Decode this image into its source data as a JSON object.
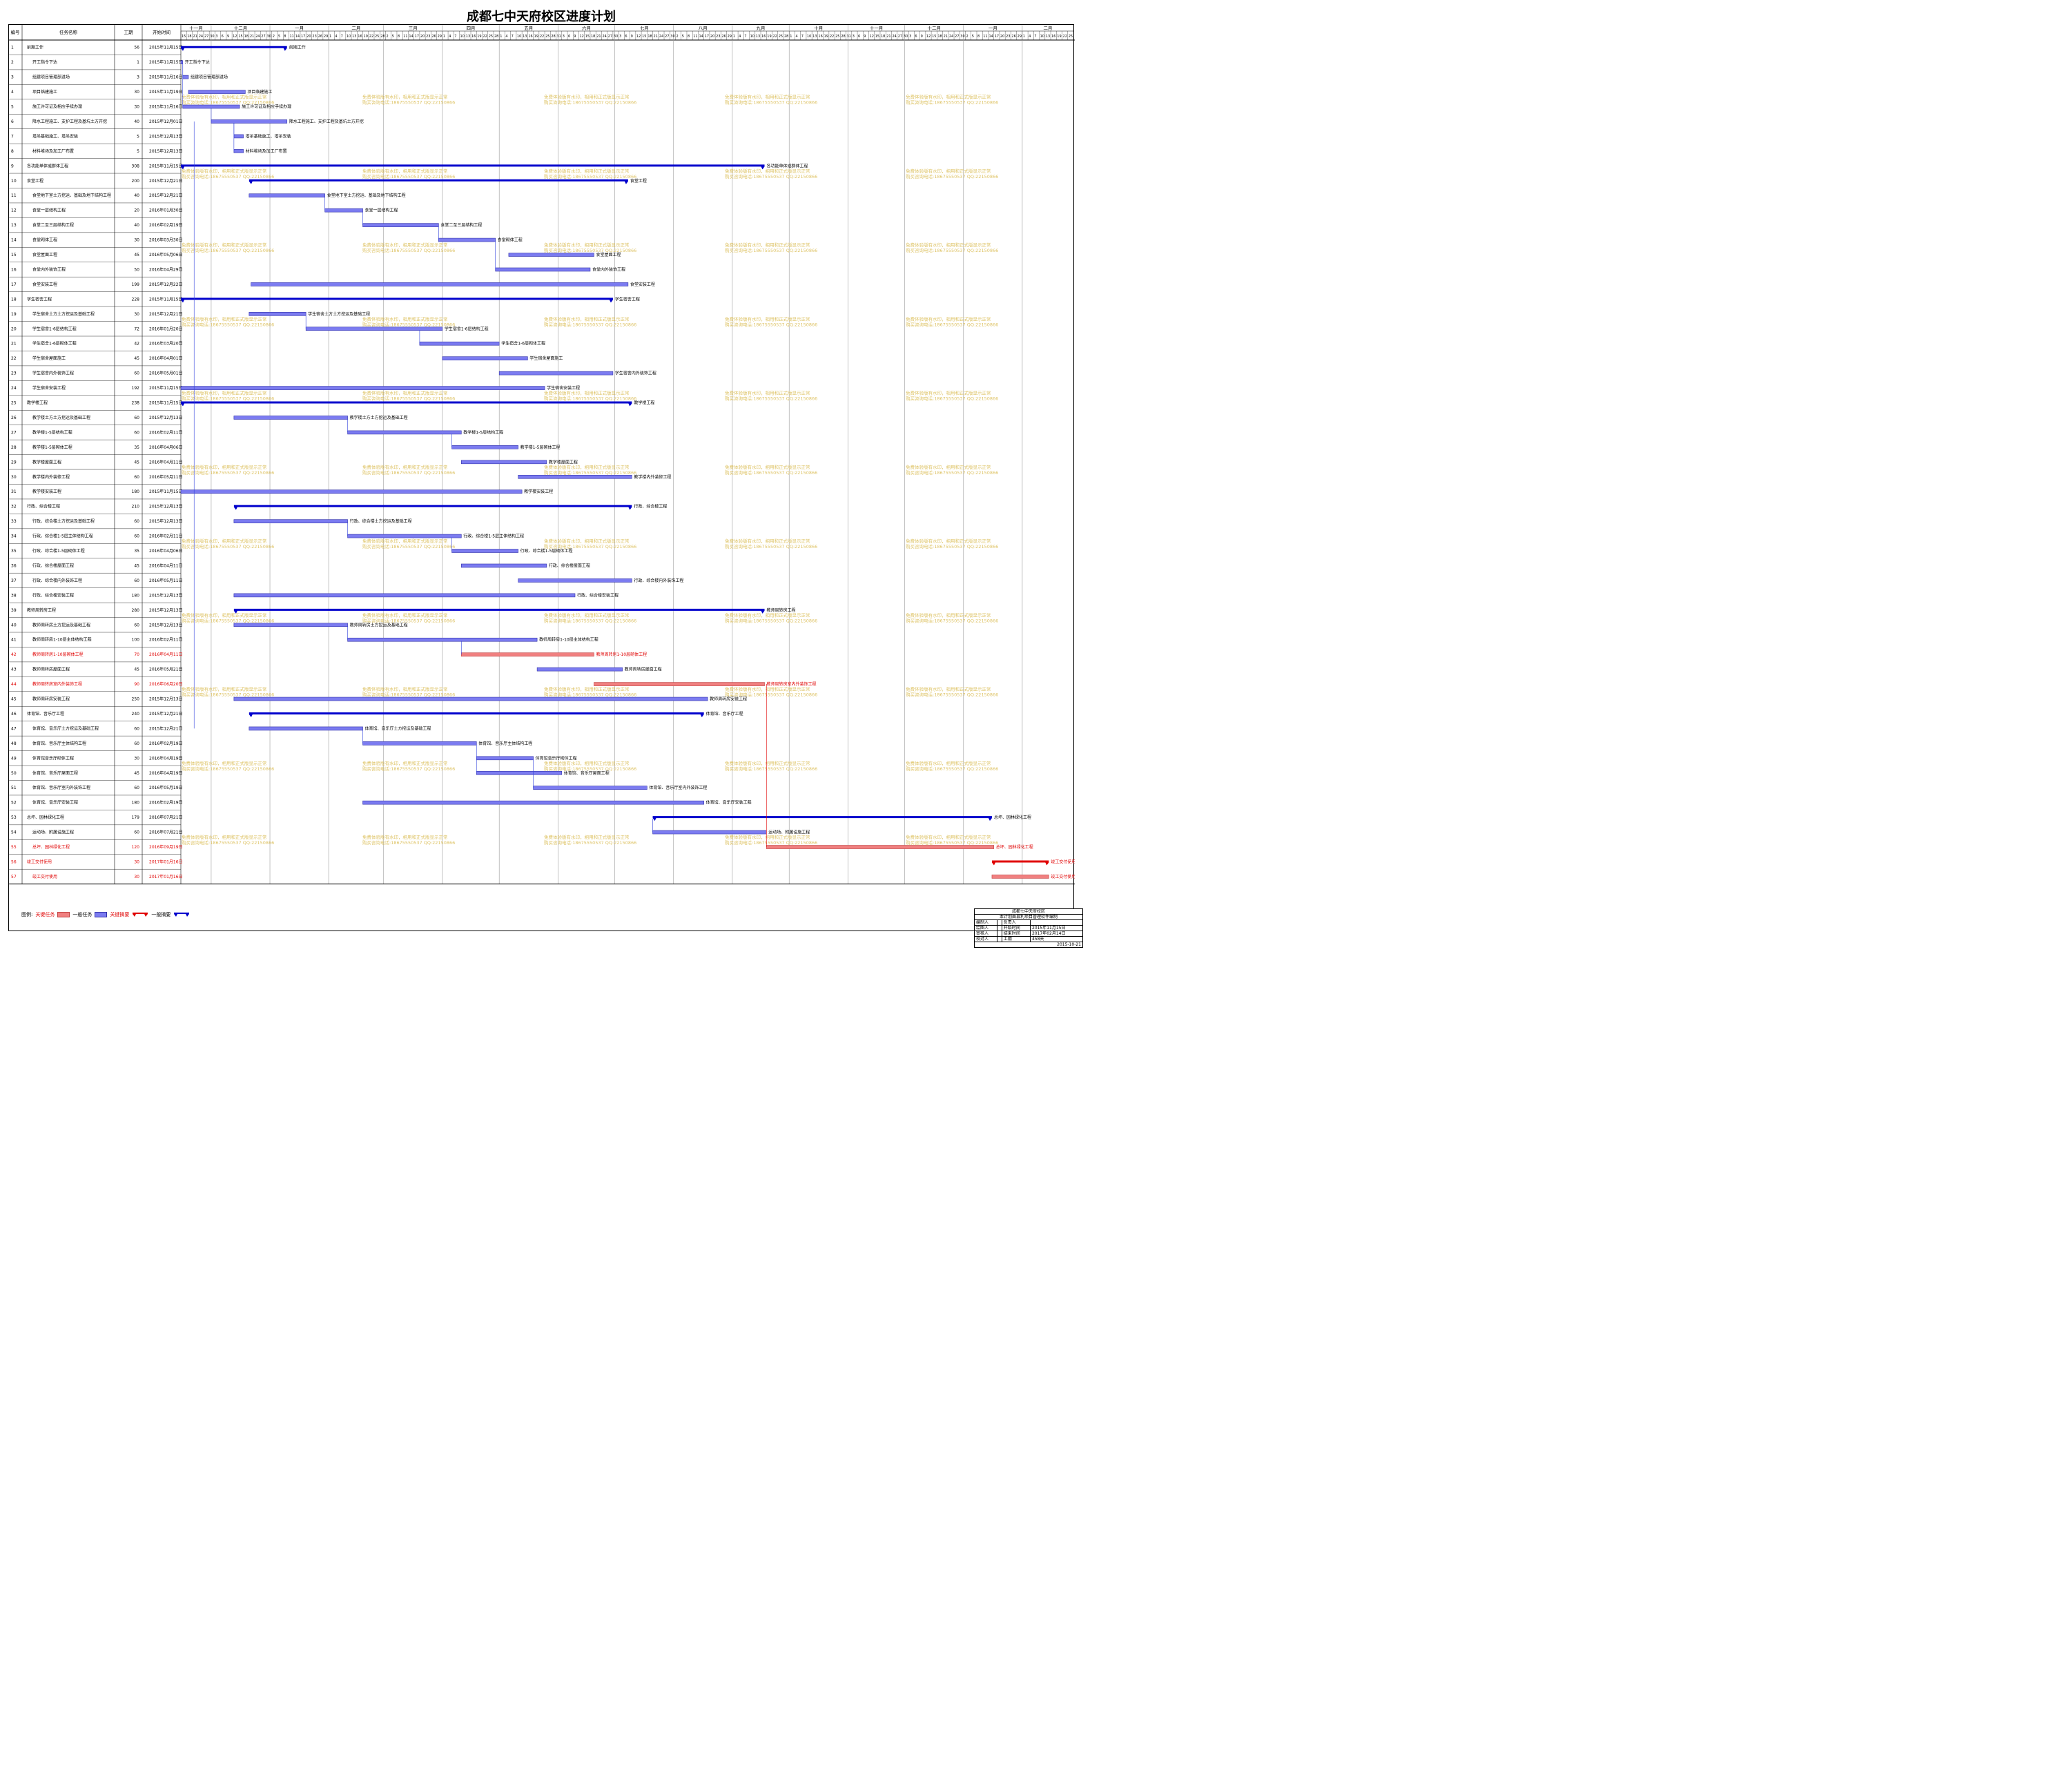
{
  "title": "成都七中天府校区进度计划",
  "columns": {
    "id": "编号",
    "name": "任务名称",
    "duration": "工期",
    "start": "开始时间"
  },
  "months": [
    {
      "label": "十一月",
      "start": "2015-11-01"
    },
    {
      "label": "十二月",
      "start": "2015-12-01"
    },
    {
      "label": "一月",
      "start": "2016-01-01"
    },
    {
      "label": "二月",
      "start": "2016-02-01"
    },
    {
      "label": "三月",
      "start": "2016-03-01"
    },
    {
      "label": "四月",
      "start": "2016-04-01"
    },
    {
      "label": "五月",
      "start": "2016-05-01"
    },
    {
      "label": "六月",
      "start": "2016-06-01"
    },
    {
      "label": "七月",
      "start": "2016-07-01"
    },
    {
      "label": "八月",
      "start": "2016-08-01"
    },
    {
      "label": "九月",
      "start": "2016-09-01"
    },
    {
      "label": "十月",
      "start": "2016-10-01"
    },
    {
      "label": "十一月",
      "start": "2016-11-01"
    },
    {
      "label": "十二月",
      "start": "2016-12-01"
    },
    {
      "label": "一月",
      "start": "2017-01-01"
    },
    {
      "label": "二月",
      "start": "2017-02-01"
    }
  ],
  "colors": {
    "task": "#7b7bf0",
    "summary": "#0000cc",
    "critical": "#f08080",
    "critical_summary": "#e00000",
    "link": "#3344dd",
    "watermark": "#d8b84a"
  },
  "watermark": {
    "line1": "免费体验版有水印，相用和正式版显示正常",
    "line2": "购买咨询电话:18675550537 QQ:22150866"
  },
  "chart_data": {
    "type": "gantt",
    "title": "成都七中天府校区进度计划",
    "x_axis": "date",
    "xlim": [
      "2015-11-15",
      "2017-02-28"
    ],
    "tasks": [
      {
        "id": "1",
        "name": "前期工作",
        "duration": "56",
        "start": "2015年11月15日",
        "kind": "summary"
      },
      {
        "id": "2",
        "name": "开工指令下达",
        "duration": "1",
        "start": "2015年11月15日",
        "kind": "task"
      },
      {
        "id": "3",
        "name": "组建项目管理部进场",
        "duration": "3",
        "start": "2015年11月16日",
        "kind": "task"
      },
      {
        "id": "4",
        "name": "项目临建施工",
        "duration": "30",
        "start": "2015年11月19日",
        "kind": "task"
      },
      {
        "id": "5",
        "name": "施工许可证及相应手续办理",
        "duration": "30",
        "start": "2015年11月16日",
        "kind": "task"
      },
      {
        "id": "6",
        "name": "降水工程施工、支护工程及基坑土方开挖",
        "duration": "40",
        "start": "2015年12月01日",
        "kind": "task"
      },
      {
        "id": "7",
        "name": "塔吊基础施工、塔吊安装",
        "duration": "5",
        "start": "2015年12月13日",
        "kind": "task"
      },
      {
        "id": "8",
        "name": "材料堆场及加工厂布置",
        "duration": "5",
        "start": "2015年12月13日",
        "kind": "task"
      },
      {
        "id": "9",
        "name": "各功能单体或群体工程",
        "duration": "308",
        "start": "2015年11月15日",
        "kind": "summary"
      },
      {
        "id": "10",
        "name": "食堂工程",
        "duration": "200",
        "start": "2015年12月21日",
        "kind": "summary"
      },
      {
        "id": "11",
        "name": "食堂地下室土方挖运、基础及地下结构工程",
        "duration": "40",
        "start": "2015年12月21日",
        "kind": "task"
      },
      {
        "id": "12",
        "name": "食堂一层结构工程",
        "duration": "20",
        "start": "2016年01月30日",
        "kind": "task"
      },
      {
        "id": "13",
        "name": "食堂二至三层结构工程",
        "duration": "40",
        "start": "2016年02月19日",
        "kind": "task"
      },
      {
        "id": "14",
        "name": "食堂砌体工程",
        "duration": "30",
        "start": "2016年03月30日",
        "kind": "task"
      },
      {
        "id": "15",
        "name": "食堂屋面工程",
        "duration": "45",
        "start": "2016年05月06日",
        "kind": "task"
      },
      {
        "id": "16",
        "name": "食堂内外装饰工程",
        "duration": "50",
        "start": "2016年04月29日",
        "kind": "task"
      },
      {
        "id": "17",
        "name": "食堂安装工程",
        "duration": "199",
        "start": "2015年12月22日",
        "kind": "task"
      },
      {
        "id": "18",
        "name": "学生宿舍工程",
        "duration": "228",
        "start": "2015年11月15日",
        "kind": "summary"
      },
      {
        "id": "19",
        "name": "学生宿舍土方土方挖运及基础工程",
        "duration": "30",
        "start": "2015年12月21日",
        "kind": "task"
      },
      {
        "id": "20",
        "name": "学生宿舍1-6层结构工程",
        "duration": "72",
        "start": "2016年01月20日",
        "kind": "task"
      },
      {
        "id": "21",
        "name": "学生宿舍1-6层砌体工程",
        "duration": "42",
        "start": "2016年03月20日",
        "kind": "task"
      },
      {
        "id": "22",
        "name": "学生宿舍屋面施工",
        "duration": "45",
        "start": "2016年04月01日",
        "kind": "task"
      },
      {
        "id": "23",
        "name": "学生宿舍内外装饰工程",
        "duration": "60",
        "start": "2016年05月01日",
        "kind": "task"
      },
      {
        "id": "24",
        "name": "学生宿舍安装工程",
        "duration": "192",
        "start": "2015年11月15日",
        "kind": "task"
      },
      {
        "id": "25",
        "name": "教学楼工程",
        "duration": "238",
        "start": "2015年11月15日",
        "kind": "summary"
      },
      {
        "id": "26",
        "name": "教学楼土方土方挖运及基础工程",
        "duration": "60",
        "start": "2015年12月13日",
        "kind": "task"
      },
      {
        "id": "27",
        "name": "教学楼1-5层结构工程",
        "duration": "60",
        "start": "2016年02月11日",
        "kind": "task"
      },
      {
        "id": "28",
        "name": "教学楼1-5层砌体工程",
        "duration": "35",
        "start": "2016年04月06日",
        "kind": "task"
      },
      {
        "id": "29",
        "name": "教学楼屋面工程",
        "duration": "45",
        "start": "2016年04月11日",
        "kind": "task"
      },
      {
        "id": "30",
        "name": "教学楼内外装修工程",
        "duration": "60",
        "start": "2016年05月11日",
        "kind": "task"
      },
      {
        "id": "31",
        "name": "教学楼安装工程",
        "duration": "180",
        "start": "2015年11月15日",
        "kind": "task"
      },
      {
        "id": "32",
        "name": "行政、综合楼工程",
        "duration": "210",
        "start": "2015年12月13日",
        "kind": "summary"
      },
      {
        "id": "33",
        "name": "行政、综合楼土方挖运及基础工程",
        "duration": "60",
        "start": "2015年12月13日",
        "kind": "task"
      },
      {
        "id": "34",
        "name": "行政、综合楼1-5层主体结构工程",
        "duration": "60",
        "start": "2016年02月11日",
        "kind": "task"
      },
      {
        "id": "35",
        "name": "行政、综合楼1-5层砌体工程",
        "duration": "35",
        "start": "2016年04月06日",
        "kind": "task"
      },
      {
        "id": "36",
        "name": "行政、综合楼屋面工程",
        "duration": "45",
        "start": "2016年04月11日",
        "kind": "task"
      },
      {
        "id": "37",
        "name": "行政、综合楼内外装饰工程",
        "duration": "60",
        "start": "2016年05月11日",
        "kind": "task"
      },
      {
        "id": "38",
        "name": "行政、综合楼安装工程",
        "duration": "180",
        "start": "2015年12月13日",
        "kind": "task"
      },
      {
        "id": "39",
        "name": "教师周转房工程",
        "duration": "280",
        "start": "2015年12月13日",
        "kind": "summary"
      },
      {
        "id": "40",
        "name": "教师周转房土方挖运及基础工程",
        "duration": "60",
        "start": "2015年12月13日",
        "kind": "task"
      },
      {
        "id": "41",
        "name": "教师周转房1-10层主体结构工程",
        "duration": "100",
        "start": "2016年02月11日",
        "kind": "task"
      },
      {
        "id": "42",
        "name": "教师周转房1-10层砌体工程",
        "duration": "70",
        "start": "2016年04月11日",
        "kind": "critical"
      },
      {
        "id": "43",
        "name": "教师周转房屋面工程",
        "duration": "45",
        "start": "2016年05月21日",
        "kind": "task"
      },
      {
        "id": "44",
        "name": "教师周转房室内外装饰工程",
        "duration": "90",
        "start": "2016年06月20日",
        "kind": "critical"
      },
      {
        "id": "45",
        "name": "教师周转房安装工程",
        "duration": "250",
        "start": "2015年12月13日",
        "kind": "task"
      },
      {
        "id": "46",
        "name": "体育馆、音乐厅工程",
        "duration": "240",
        "start": "2015年12月21日",
        "kind": "summary"
      },
      {
        "id": "47",
        "name": "体育馆、音乐厅土方挖运及基础工程",
        "duration": "60",
        "start": "2015年12月21日",
        "kind": "task"
      },
      {
        "id": "48",
        "name": "体育馆、音乐厅主体结构工程",
        "duration": "60",
        "start": "2016年02月19日",
        "kind": "task"
      },
      {
        "id": "49",
        "name": "体育馆音乐厅砌体工程",
        "duration": "30",
        "start": "2016年04月19日",
        "kind": "task"
      },
      {
        "id": "50",
        "name": "体育馆、音乐厅屋面工程",
        "duration": "45",
        "start": "2016年04月19日",
        "kind": "task"
      },
      {
        "id": "51",
        "name": "体育馆、音乐厅室内外装饰工程",
        "duration": "60",
        "start": "2016年05月19日",
        "kind": "task"
      },
      {
        "id": "52",
        "name": "体育馆、音乐厅安装工程",
        "duration": "180",
        "start": "2016年02月19日",
        "kind": "task"
      },
      {
        "id": "53",
        "name": "总坪、园林绿化工程",
        "duration": "179",
        "start": "2016年07月21日",
        "kind": "summary"
      },
      {
        "id": "54",
        "name": "运动场、附属设施工程",
        "duration": "60",
        "start": "2016年07月21日",
        "kind": "task"
      },
      {
        "id": "55",
        "name": "总坪、园林绿化工程",
        "duration": "120",
        "start": "2016年09月19日",
        "kind": "critical"
      },
      {
        "id": "56",
        "name": "竣工交付使用",
        "duration": "30",
        "start": "2017年01月16日",
        "kind": "critical_summary"
      },
      {
        "id": "57",
        "name": "竣工交付使用",
        "duration": "30",
        "start": "2017年01月16日",
        "kind": "critical"
      }
    ]
  },
  "legend": {
    "label": "图例:",
    "items": [
      {
        "label": "关键任务",
        "style": "critical",
        "text_color": "#e00000"
      },
      {
        "label": "一般任务",
        "style": "task",
        "text_color": "#000000"
      },
      {
        "label": "关键摘要",
        "style": "critical_summary",
        "text_color": "#e00000"
      },
      {
        "label": "一般摘要",
        "style": "summary",
        "text_color": "#000000"
      }
    ]
  },
  "info": {
    "project": "成都七中天府校区",
    "note": "本计划由县利项目管理软件编制",
    "rows": [
      [
        "编制人",
        "",
        "负责人",
        ""
      ],
      [
        "绘图人",
        "",
        "开始时间",
        "2015年11月15日"
      ],
      [
        "审核人",
        "",
        "结束时间",
        "2017年02月14日"
      ],
      [
        "校对人",
        "",
        "工期",
        "458天"
      ]
    ],
    "date": "2015-10-21"
  }
}
